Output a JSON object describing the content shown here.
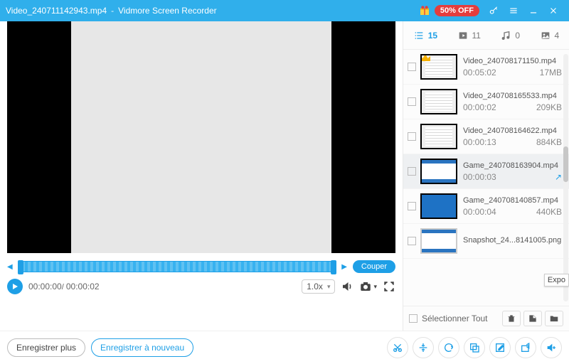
{
  "title": {
    "file": "Video_240711142943.mp4",
    "app": "Vidmore Screen Recorder"
  },
  "promo": {
    "off_label": "50% OFF"
  },
  "player": {
    "time_current": "00:00:00",
    "time_total": "00:00:02",
    "cut_label": "Couper",
    "speed": "1.0x"
  },
  "tabs": {
    "list_count": "15",
    "video_count": "11",
    "audio_count": "0",
    "image_count": "4"
  },
  "items": [
    {
      "name": "Video_240708171150.mp4",
      "dur": "00:05:02",
      "size": "17MB",
      "thumb": "doc",
      "crown": true
    },
    {
      "name": "Video_240708165533.mp4",
      "dur": "00:00:02",
      "size": "209KB",
      "thumb": "doc"
    },
    {
      "name": "Video_240708164622.mp4",
      "dur": "00:00:13",
      "size": "884KB",
      "thumb": "doc"
    },
    {
      "name": "Game_240708163904.mp4",
      "dur": "00:00:03",
      "size": "",
      "thumb": "desk",
      "selected": true,
      "share": true
    },
    {
      "name": "Game_240708140857.mp4",
      "dur": "00:00:04",
      "size": "440KB",
      "thumb": "blue"
    },
    {
      "name": "Snapshot_24...8141005.png",
      "dur": "",
      "size": "",
      "thumb": "desk_nb"
    }
  ],
  "select_all": "Sélectionner Tout",
  "tooltip_export": "Expo",
  "bottom": {
    "record_more": "Enregistrer plus",
    "record_again": "Enregistrer à nouveau"
  }
}
